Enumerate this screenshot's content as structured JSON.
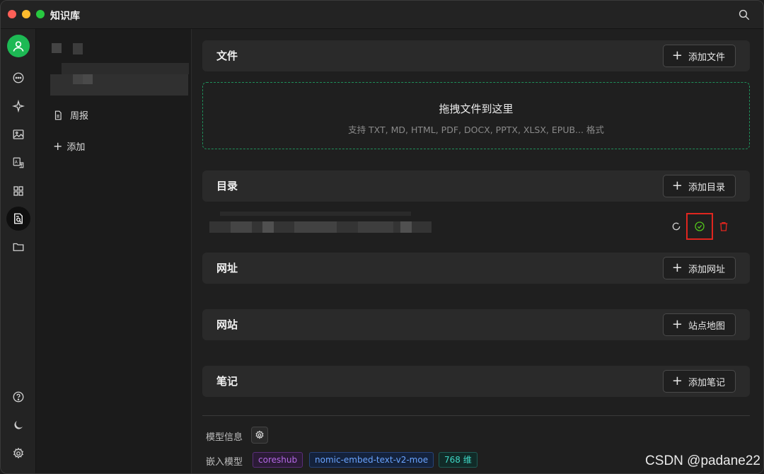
{
  "app": {
    "title": "知识库"
  },
  "sidebar": {
    "items": [
      {
        "label": "周报",
        "icon": "document-icon"
      },
      {
        "label": "添加",
        "icon": "plus-icon"
      }
    ]
  },
  "rail": {
    "icons": [
      "user-avatar-icon",
      "chat-icon",
      "sparkle-icon",
      "image-icon",
      "translate-icon",
      "apps-grid-icon",
      "knowledge-base-icon",
      "folder-icon",
      "help-icon",
      "moon-icon",
      "settings-icon"
    ]
  },
  "sections": {
    "files": {
      "title": "文件",
      "button": "添加文件"
    },
    "dropzone": {
      "title": "拖拽文件到这里",
      "hint": "支持 TXT, MD, HTML, PDF, DOCX, PPTX, XLSX, EPUB... 格式"
    },
    "directory": {
      "title": "目录",
      "button": "添加目录"
    },
    "url": {
      "title": "网址",
      "button": "添加网址"
    },
    "website": {
      "title": "网站",
      "button": "站点地图"
    },
    "notes": {
      "title": "笔记",
      "button": "添加笔记"
    }
  },
  "model_info": {
    "label": "模型信息",
    "embed_label": "嵌入模型",
    "tags": {
      "provider": "coreshub",
      "model": "nomic-embed-text-v2-moe",
      "dims": "768 维"
    }
  },
  "colors": {
    "accent": "#1db954",
    "danger": "#e0261f",
    "success": "#52c41a"
  },
  "watermark": "CSDN @padane22"
}
